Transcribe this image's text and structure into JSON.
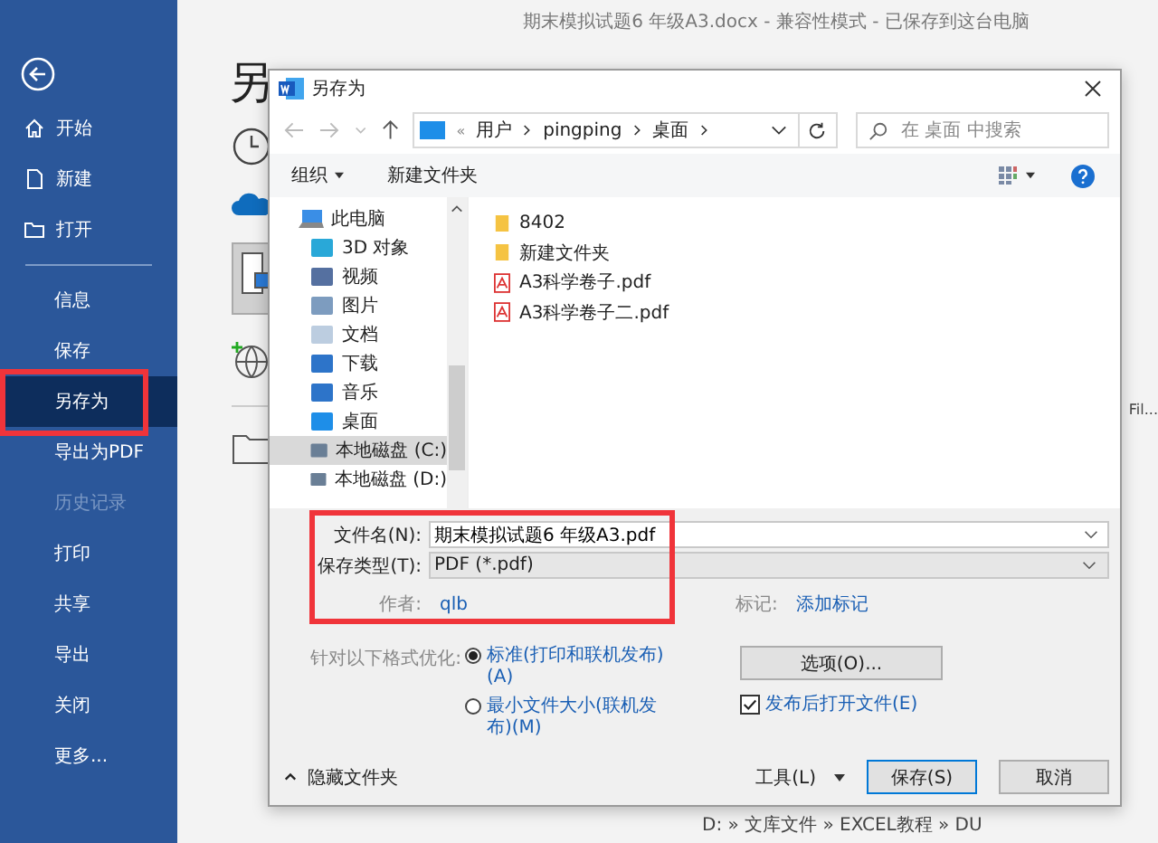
{
  "app_title": "期末模拟试题6 年级A3.docx  -  兼容性模式  -  已保存到这台电脑",
  "sidebar": {
    "items": [
      {
        "label": "开始",
        "kind": "main",
        "selected": false,
        "disabled": false
      },
      {
        "label": "新建",
        "kind": "main",
        "selected": false,
        "disabled": false
      },
      {
        "label": "打开",
        "kind": "main",
        "selected": false,
        "disabled": false
      },
      {
        "label": "信息",
        "kind": "sub",
        "selected": false,
        "disabled": false
      },
      {
        "label": "保存",
        "kind": "sub",
        "selected": false,
        "disabled": false
      },
      {
        "label": "另存为",
        "kind": "sub",
        "selected": true,
        "disabled": false
      },
      {
        "label": "导出为PDF",
        "kind": "sub",
        "selected": false,
        "disabled": false
      },
      {
        "label": "历史记录",
        "kind": "sub",
        "selected": false,
        "disabled": true
      },
      {
        "label": "打印",
        "kind": "sub",
        "selected": false,
        "disabled": false
      },
      {
        "label": "共享",
        "kind": "sub",
        "selected": false,
        "disabled": false
      },
      {
        "label": "导出",
        "kind": "sub",
        "selected": false,
        "disabled": false
      },
      {
        "label": "关闭",
        "kind": "sub",
        "selected": false,
        "disabled": false
      },
      {
        "label": "更多...",
        "kind": "sub",
        "selected": false,
        "disabled": false
      }
    ]
  },
  "page_title": "另",
  "behind": {
    "column_label": "Fil...",
    "path": "D: » 文库文件 » EXCEL教程 » DU"
  },
  "dialog": {
    "title": "另存为",
    "address_overflow": "«",
    "address": [
      "用户",
      "pingping",
      "桌面"
    ],
    "search": {
      "placeholder": "在 桌面 中搜索"
    },
    "toolbar": [
      "组织",
      "新建文件夹"
    ],
    "tree": [
      {
        "label": "此电脑",
        "selected": false,
        "children": [
          {
            "label": "3D 对象",
            "selected": false
          },
          {
            "label": "视频",
            "selected": false
          },
          {
            "label": "图片",
            "selected": false
          },
          {
            "label": "文档",
            "selected": false
          },
          {
            "label": "下载",
            "selected": false
          },
          {
            "label": "音乐",
            "selected": false
          },
          {
            "label": "桌面",
            "selected": false
          },
          {
            "label": "本地磁盘 (C:)",
            "selected": true
          },
          {
            "label": "本地磁盘 (D:)",
            "selected": false
          }
        ]
      }
    ],
    "files": [
      {
        "name": "8402",
        "kind": "folder"
      },
      {
        "name": "新建文件夹",
        "kind": "folder"
      },
      {
        "name": "A3科学卷子.pdf",
        "kind": "pdf"
      },
      {
        "name": "A3科学卷子二.pdf",
        "kind": "pdf"
      }
    ],
    "filename": {
      "label": "文件名(N):",
      "value": "期末模拟试题6 年级A3.pdf"
    },
    "filetype": {
      "label": "保存类型(T):",
      "value": "PDF (*.pdf)"
    },
    "author": {
      "label": "作者:",
      "value": "qlb"
    },
    "tags": {
      "label": "标记:",
      "value": "添加标记"
    },
    "optimize": {
      "label": "针对以下格式优化:",
      "options": [
        {
          "label": "标准(打印和联机发布)(A)",
          "selected": true
        },
        {
          "label": "最小文件大小(联机发布)(M)",
          "selected": false
        }
      ]
    },
    "options_button": "选项(O)...",
    "open_after": {
      "label": "发布后打开文件(E)",
      "checked": true
    },
    "hide_folders": "隐藏文件夹",
    "tools": "工具(L)",
    "save": "保存(S)",
    "cancel": "取消"
  }
}
